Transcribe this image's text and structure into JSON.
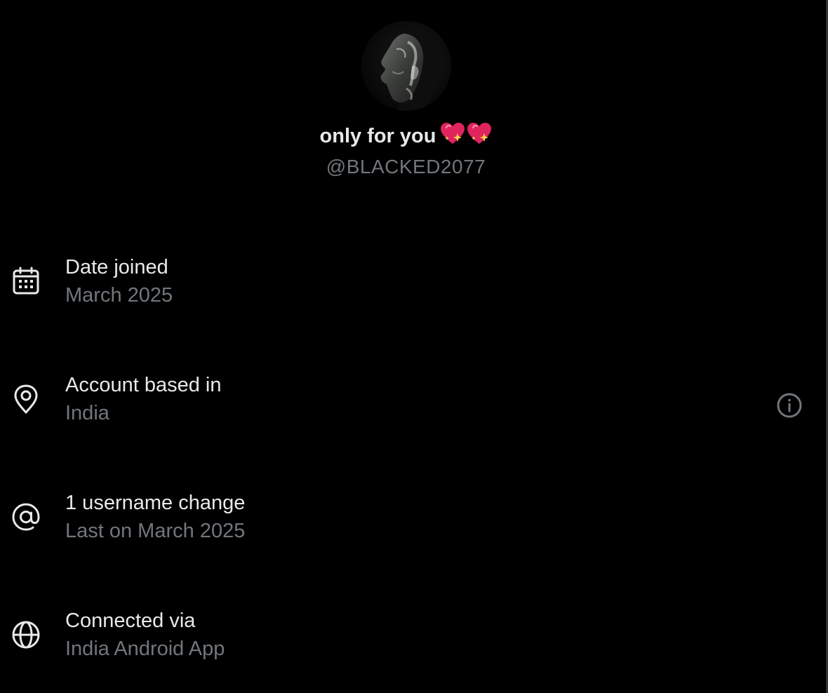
{
  "profile": {
    "display_name": "only for you",
    "name_emoji": [
      "sparkling-heart",
      "sparkling-heart"
    ],
    "handle": "@BLACKED2077"
  },
  "rows": [
    {
      "icon": "calendar-icon",
      "title": "Date joined",
      "value": "March 2025"
    },
    {
      "icon": "location-pin-icon",
      "title": "Account based in",
      "value": "India",
      "has_info_button": true
    },
    {
      "icon": "at-sign-icon",
      "title": "1 username change",
      "value": "Last on March 2025"
    },
    {
      "icon": "globe-icon",
      "title": "Connected via",
      "value": "India Android App"
    }
  ],
  "colors": {
    "background": "#000000",
    "primary_text": "#e7e9ea",
    "secondary_text": "#71767b",
    "heart": "#e0245e"
  }
}
